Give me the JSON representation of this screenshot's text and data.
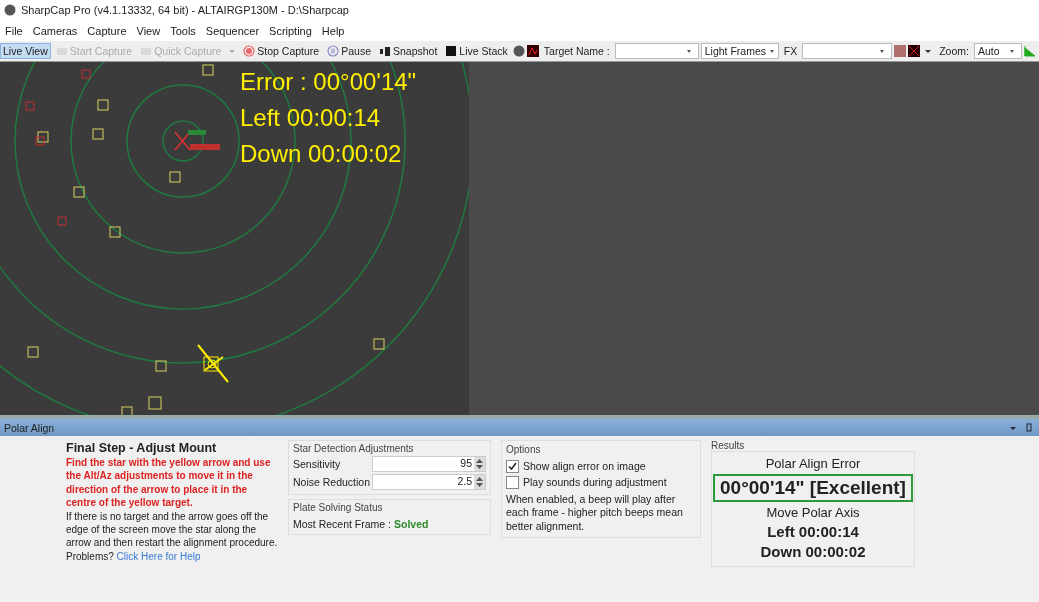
{
  "window": {
    "title": "SharpCap Pro (v4.1.13332, 64 bit) - ALTAIRGP130M - D:\\Sharpcap"
  },
  "menu": [
    "File",
    "Cameras",
    "Capture",
    "View",
    "Tools",
    "Sequencer",
    "Scripting",
    "Help"
  ],
  "toolbar": {
    "buttons": [
      {
        "label": "Live View",
        "selected": true,
        "disabled": false
      },
      {
        "label": "Start Capture",
        "selected": false,
        "disabled": true
      },
      {
        "label": "Quick Capture",
        "selected": false,
        "disabled": true
      },
      {
        "label": "Stop Capture",
        "selected": false,
        "disabled": false
      },
      {
        "label": "Pause",
        "selected": false,
        "disabled": false
      },
      {
        "label": "Snapshot",
        "selected": false,
        "disabled": false
      },
      {
        "label": "Live Stack",
        "selected": false,
        "disabled": false
      }
    ],
    "target_label": "Target Name :",
    "frame_type": "Light Frames",
    "fx_label": "FX",
    "zoom_label": "Zoom:",
    "zoom_value": "Auto"
  },
  "overlay": {
    "error": "Error : 00°00'14\"",
    "left": "Left 00:00:14",
    "down": "Down 00:00:02"
  },
  "panel": {
    "title": "Polar Align",
    "step_title": "Final Step - Adjust Mount",
    "instruction": "Find the star with the yellow arrow and use the Alt/Az adjustments to move it in the direction of the arrow to place it in the centre of the yellow target.",
    "note": "If there is no target and the arrow goes off the edge of the screen move the star along the arrow and then restart the alignment procedure.",
    "problems": "Problems?",
    "help_link": "Click Here for Help",
    "star_detection": {
      "title": "Star Detection Adjustments",
      "fields": [
        {
          "label": "Sensitivity",
          "value": "95"
        },
        {
          "label": "Noise Reduction",
          "value": "2.5"
        }
      ]
    },
    "plate_solving": {
      "title": "Plate Solving Status",
      "label": "Most Recent Frame :",
      "status": "Solved"
    },
    "options": {
      "title": "Options",
      "checkboxes": [
        {
          "label": "Show align error on image",
          "checked": true
        },
        {
          "label": "Play sounds during adjustment",
          "checked": false
        }
      ],
      "note": "When enabled, a beep will play after each frame - higher pitch beeps mean better alignment."
    },
    "results": {
      "title": "Results",
      "heading": "Polar Align Error",
      "error": "00°00'14\" [Excellent]",
      "move_heading": "Move Polar Axis",
      "left": "Left 00:00:14",
      "down": "Down 00:00:02"
    }
  }
}
